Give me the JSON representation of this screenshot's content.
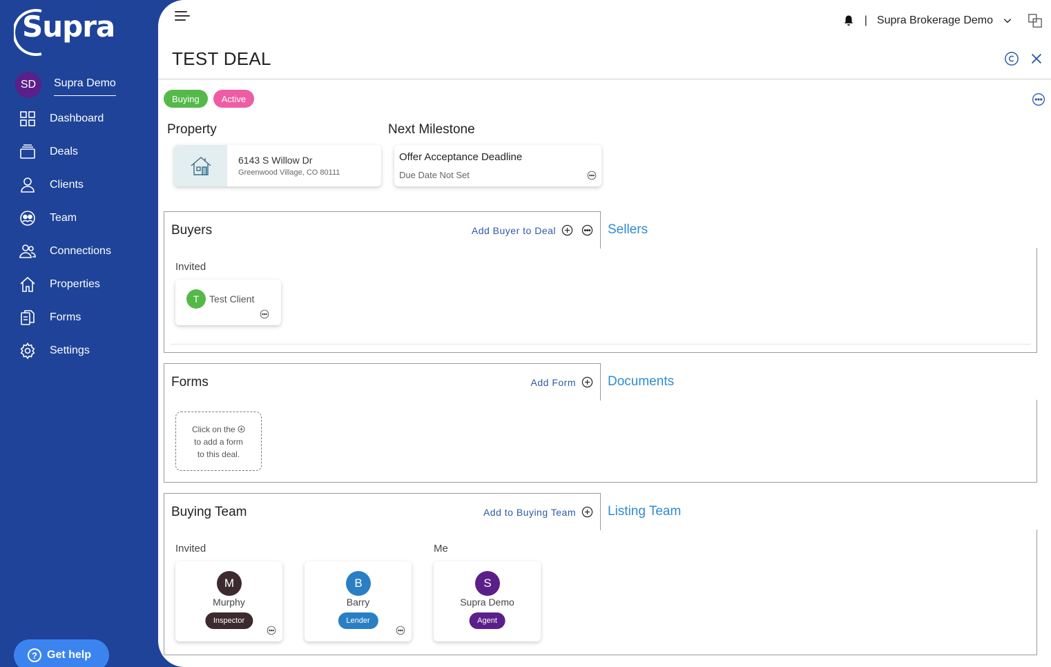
{
  "sidebar": {
    "logo_text": "Supra",
    "user": {
      "initials": "SD",
      "name": "Supra Demo"
    },
    "items": [
      {
        "label": "Dashboard",
        "icon": "dashboard-icon"
      },
      {
        "label": "Deals",
        "icon": "deals-icon"
      },
      {
        "label": "Clients",
        "icon": "clients-icon"
      },
      {
        "label": "Team",
        "icon": "team-icon"
      },
      {
        "label": "Connections",
        "icon": "connections-icon"
      },
      {
        "label": "Properties",
        "icon": "properties-icon"
      },
      {
        "label": "Forms",
        "icon": "forms-icon"
      },
      {
        "label": "Settings",
        "icon": "settings-icon"
      }
    ],
    "help_label": "Get help"
  },
  "topbar": {
    "separator": "|",
    "brokerage": "Supra Brokerage Demo"
  },
  "deal": {
    "title": "TEST DEAL",
    "badges": [
      {
        "label": "Buying",
        "color": "#54b948"
      },
      {
        "label": "Active",
        "color": "#ee5ca4"
      }
    ]
  },
  "property": {
    "section_label": "Property",
    "address": "6143 S Willow Dr",
    "city": "Greenwood Village,  CO  80111"
  },
  "milestone": {
    "section_label": "Next Milestone",
    "name": "Offer Acceptance Deadline",
    "due": "Due Date Not Set"
  },
  "buyers": {
    "tab_title": "Buyers",
    "action_label": "Add Buyer to Deal",
    "other_tab": "Sellers",
    "group_label": "Invited",
    "clients": [
      {
        "initial": "T",
        "name": "Test Client"
      }
    ]
  },
  "forms": {
    "tab_title": "Forms",
    "action_label": "Add Form",
    "other_tab": "Documents",
    "empty_line1": "Click on the",
    "empty_line2": "to add a form",
    "empty_line3": "to this deal."
  },
  "team": {
    "tab_title": "Buying Team",
    "action_label": "Add to Buying Team",
    "other_tab": "Listing Team",
    "invited_label": "Invited",
    "me_label": "Me",
    "members": [
      {
        "initial": "M",
        "name": "Murphy",
        "role": "Inspector",
        "avatar_color": "#3d2a2e",
        "role_color": "#3d2a2e"
      },
      {
        "initial": "B",
        "name": "Barry",
        "role": "Lender",
        "avatar_color": "#2a7fc4",
        "role_color": "#2a7fc4"
      },
      {
        "initial": "S",
        "name": "Supra Demo",
        "role": "Agent",
        "avatar_color": "#5b1f8a",
        "role_color": "#5b1f8a"
      }
    ]
  }
}
